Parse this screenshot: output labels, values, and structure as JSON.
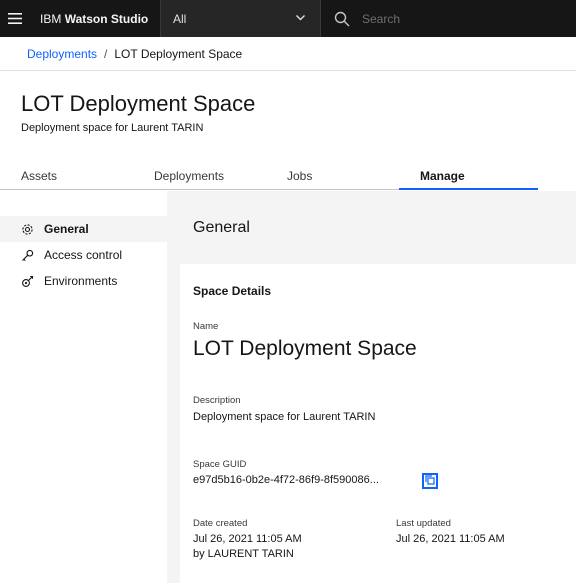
{
  "topbar": {
    "product_prefix": "IBM",
    "product_name": "Watson Studio",
    "scope_value": "All",
    "search_placeholder": "Search"
  },
  "breadcrumb": {
    "parent": "Deployments",
    "separator": "/",
    "current": "LOT Deployment Space"
  },
  "header": {
    "title": "LOT Deployment Space",
    "subtitle": "Deployment space for Laurent TARIN"
  },
  "tabs": [
    {
      "label": "Assets"
    },
    {
      "label": "Deployments"
    },
    {
      "label": "Jobs"
    },
    {
      "label": "Manage"
    }
  ],
  "sidebar": {
    "items": [
      {
        "label": "General",
        "icon": "gear-icon"
      },
      {
        "label": "Access control",
        "icon": "key-icon"
      },
      {
        "label": "Environments",
        "icon": "tools-icon"
      }
    ]
  },
  "main": {
    "title": "General",
    "card_heading": "Space Details",
    "name_label": "Name",
    "name_value": "LOT Deployment Space",
    "description_label": "Description",
    "description_value": "Deployment space for Laurent TARIN",
    "guid_label": "Space GUID",
    "guid_value": "e97d5b16-0b2e-4f72-86f9-8f590086...",
    "created_label": "Date created",
    "created_value": "Jul 26, 2021 11:05 AM",
    "created_by": "by LAURENT TARIN",
    "updated_label": "Last updated",
    "updated_value": "Jul 26, 2021 11:05 AM"
  },
  "colors": {
    "accent": "#0f62fe",
    "topbar_bg": "#161616",
    "panel_bg": "#f4f4f4"
  }
}
